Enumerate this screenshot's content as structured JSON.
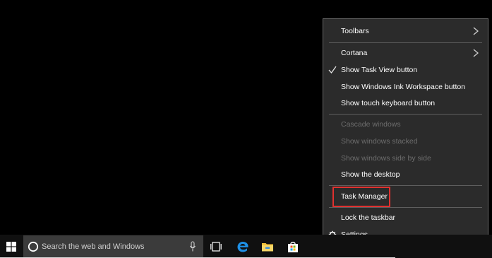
{
  "context_menu": {
    "items": [
      {
        "label": "Toolbars",
        "submenu": true,
        "enabled": true
      },
      {
        "label": "Cortana",
        "submenu": true,
        "enabled": true
      },
      {
        "label": "Show Task View button",
        "checked": true,
        "enabled": true
      },
      {
        "label": "Show Windows Ink Workspace button",
        "enabled": true
      },
      {
        "label": "Show touch keyboard button",
        "enabled": true
      },
      {
        "label": "Cascade windows",
        "enabled": false
      },
      {
        "label": "Show windows stacked",
        "enabled": false
      },
      {
        "label": "Show windows side by side",
        "enabled": false
      },
      {
        "label": "Show the desktop",
        "enabled": true
      },
      {
        "label": "Task Manager",
        "enabled": true,
        "highlighted": true
      },
      {
        "label": "Lock the taskbar",
        "enabled": true
      },
      {
        "label": "Settings",
        "icon": "gear-icon",
        "enabled": true
      }
    ],
    "highlight_color": "#e0312f"
  },
  "taskbar": {
    "search_placeholder": "Search the web and Windows",
    "icons": [
      "windows-logo-icon",
      "cortana-icon",
      "microphone-icon",
      "task-view-icon",
      "edge-icon",
      "file-explorer-icon",
      "store-icon"
    ]
  },
  "colors": {
    "desktop": "#000000",
    "menu_bg": "#2b2b2b",
    "menu_text": "#ffffff",
    "menu_disabled_text": "#6d6d6d",
    "taskbar_bg": "#101010",
    "search_bg": "#3b3b3b",
    "edge_blue": "#1e90e6",
    "explorer_yellow": "#f3c13a"
  }
}
